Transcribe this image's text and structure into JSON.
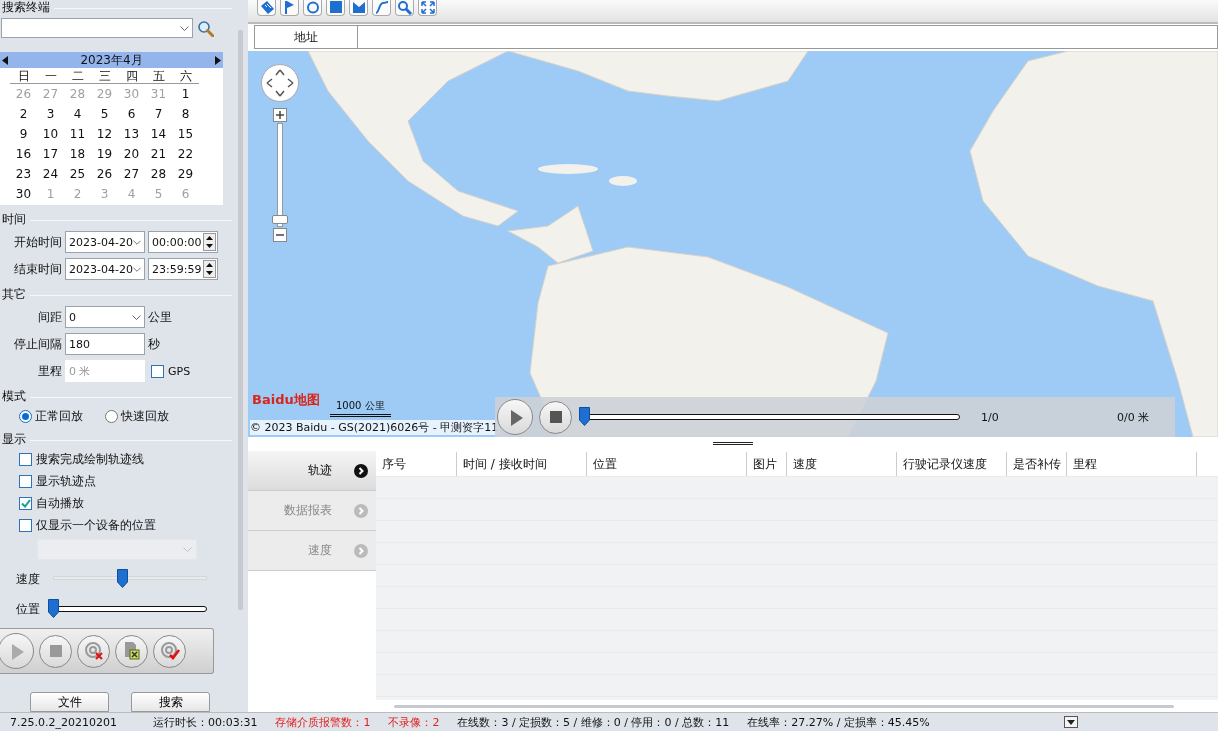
{
  "search_terminal": {
    "title": "搜索终端"
  },
  "calendar": {
    "month": "2023年4月",
    "weekdays": [
      "日",
      "一",
      "二",
      "三",
      "四",
      "五",
      "六"
    ],
    "weeks": [
      [
        {
          "day": "26",
          "other_month": true
        },
        {
          "day": "27",
          "other_month": true
        },
        {
          "day": "28",
          "other_month": true
        },
        {
          "day": "29",
          "other_month": true
        },
        {
          "day": "30",
          "other_month": true
        },
        {
          "day": "31",
          "other_month": true
        },
        {
          "day": "1",
          "other_month": false
        }
      ],
      [
        {
          "day": "2",
          "other_month": false
        },
        {
          "day": "3",
          "other_month": false
        },
        {
          "day": "4",
          "other_month": false
        },
        {
          "day": "5",
          "other_month": false
        },
        {
          "day": "6",
          "other_month": false
        },
        {
          "day": "7",
          "other_month": false
        },
        {
          "day": "8",
          "other_month": false
        }
      ],
      [
        {
          "day": "9",
          "other_month": false
        },
        {
          "day": "10",
          "other_month": false
        },
        {
          "day": "11",
          "other_month": false
        },
        {
          "day": "12",
          "other_month": false
        },
        {
          "day": "13",
          "other_month": false
        },
        {
          "day": "14",
          "other_month": false
        },
        {
          "day": "15",
          "other_month": false
        }
      ],
      [
        {
          "day": "16",
          "other_month": false
        },
        {
          "day": "17",
          "other_month": false
        },
        {
          "day": "18",
          "other_month": false
        },
        {
          "day": "19",
          "other_month": false
        },
        {
          "day": "20",
          "other_month": false
        },
        {
          "day": "21",
          "other_month": false
        },
        {
          "day": "22",
          "other_month": false
        }
      ],
      [
        {
          "day": "23",
          "other_month": false
        },
        {
          "day": "24",
          "other_month": false
        },
        {
          "day": "25",
          "other_month": false
        },
        {
          "day": "26",
          "other_month": false
        },
        {
          "day": "27",
          "other_month": false
        },
        {
          "day": "28",
          "other_month": false
        },
        {
          "day": "29",
          "other_month": false
        }
      ],
      [
        {
          "day": "30",
          "other_month": false
        },
        {
          "day": "1",
          "other_month": true
        },
        {
          "day": "2",
          "other_month": true
        },
        {
          "day": "3",
          "other_month": true
        },
        {
          "day": "4",
          "other_month": true
        },
        {
          "day": "5",
          "other_month": true
        },
        {
          "day": "6",
          "other_month": true
        }
      ]
    ]
  },
  "time": {
    "title": "时间",
    "rows": [
      {
        "label": "开始时间",
        "date": "2023-04-20",
        "time": "00:00:00"
      },
      {
        "label": "结束时间",
        "date": "2023-04-20",
        "time": "23:59:59"
      }
    ]
  },
  "other": {
    "title": "其它",
    "distance": {
      "label": "间距",
      "value": "0",
      "unit": "公里"
    },
    "stop_interval": {
      "label": "停止间隔",
      "value": "180",
      "unit": "秒"
    },
    "mileage": {
      "label": "里程",
      "value": "0 米",
      "disabled": true
    },
    "gps": {
      "label": "GPS",
      "checked": false
    }
  },
  "mode": {
    "title": "模式",
    "options": [
      {
        "label": "正常回放",
        "selected": true
      },
      {
        "label": "快速回放",
        "selected": false
      }
    ]
  },
  "display": {
    "title": "显示",
    "options": [
      {
        "label": "搜索完成绘制轨迹线",
        "checked": false
      },
      {
        "label": "显示轨迹点",
        "checked": false
      },
      {
        "label": "自动播放",
        "checked": true
      },
      {
        "label": "仅显示一个设备的位置",
        "checked": false
      }
    ],
    "device_select": {
      "disabled": true
    }
  },
  "sliders": [
    {
      "label": "速度",
      "level": 0.45
    },
    {
      "label": "位置",
      "level": 0
    }
  ],
  "playback_buttons": [
    {
      "kind": "play"
    },
    {
      "kind": "stop"
    },
    {
      "kind": "clear-track"
    },
    {
      "kind": "clear-file"
    },
    {
      "kind": "confirm"
    }
  ],
  "bottom_buttons": [
    "文件",
    "搜索"
  ],
  "toolbar": [
    {
      "kind": "ruler"
    },
    {
      "kind": "flag"
    },
    {
      "kind": "circle"
    },
    {
      "kind": "square"
    },
    {
      "kind": "polygon"
    },
    {
      "kind": "curve"
    },
    {
      "kind": "search"
    },
    {
      "kind": "fullscreen"
    }
  ],
  "address": {
    "label": "地址"
  },
  "map": {
    "logo": "Baidu地图",
    "scale": "1000 公里",
    "copyright": "© 2023 Baidu - GS(2021)6026号 - 甲测资字11"
  },
  "player": {
    "level": 0,
    "position": "1/0",
    "distance": "0/0 米"
  },
  "side_tabs": [
    {
      "label": "轨迹",
      "selected": true
    },
    {
      "label": "数据报表",
      "selected": false
    },
    {
      "label": "速度",
      "selected": false
    }
  ],
  "table": {
    "columns": [
      "序号",
      "时间 / 接收时间",
      "位置",
      "图片",
      "速度",
      "行驶记录仪速度",
      "是否补传",
      "里程"
    ]
  },
  "status_bar": [
    {
      "text": "7.25.0.2_20210201",
      "alert": false
    },
    {
      "text": "运行时长：00:03:31",
      "alert": false
    },
    {
      "text": "存储介质报警数：1",
      "alert": true
    },
    {
      "text": "不录像：2",
      "alert": true
    },
    {
      "text": "在线数：3 / 定损数：5 / 维修：0 / 停用：0 / 总数：11",
      "alert": false
    },
    {
      "text": "在线率：27.27% / 定损率：45.45%",
      "alert": false
    }
  ]
}
